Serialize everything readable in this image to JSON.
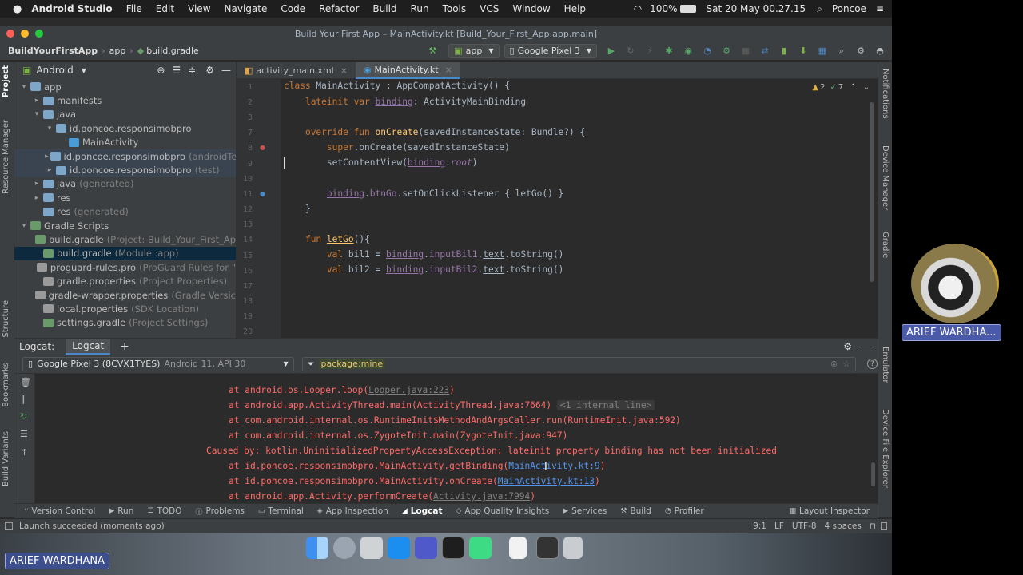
{
  "menubar": {
    "app": "Android Studio",
    "items": [
      "File",
      "Edit",
      "View",
      "Navigate",
      "Code",
      "Refactor",
      "Build",
      "Run",
      "Tools",
      "VCS",
      "Window",
      "Help"
    ],
    "battery": "100%",
    "clock": "Sat 20 May  00.27.15",
    "user": "Poncoe"
  },
  "window": {
    "title": "Build Your First App – MainActivity.kt [Build_Your_First_App.app.main]"
  },
  "nav": {
    "breadcrumb": [
      "BuildYourFirstApp",
      "app",
      "build.gradle"
    ],
    "module": "app",
    "device": "Google Pixel 3"
  },
  "side_left": [
    "Project",
    "Resource Manager",
    "Structure",
    "Bookmarks",
    "Build Variants"
  ],
  "side_right": [
    "Notifications",
    "Device Manager",
    "Gradle",
    "Emulator",
    "Device File Explorer"
  ],
  "project": {
    "view": "Android",
    "rows": [
      {
        "indent": 0,
        "arrow": "▾",
        "label": "app",
        "hint": "",
        "color": "#7ea6c9"
      },
      {
        "indent": 1,
        "arrow": "▸",
        "label": "manifests",
        "hint": "",
        "color": "#7ea6c9"
      },
      {
        "indent": 1,
        "arrow": "▾",
        "label": "java",
        "hint": "",
        "color": "#7ea6c9"
      },
      {
        "indent": 2,
        "arrow": "▾",
        "label": "id.poncoe.responsimobpro",
        "hint": "",
        "color": "#7ea6c9"
      },
      {
        "indent": 3,
        "arrow": "",
        "label": "MainActivity",
        "hint": "",
        "color": "#4a9cd6"
      },
      {
        "indent": 2,
        "arrow": "▸",
        "label": "id.poncoe.responsimobpro",
        "hint": "(androidTe",
        "color": "#7ea6c9",
        "sel": true
      },
      {
        "indent": 2,
        "arrow": "▸",
        "label": "id.poncoe.responsimobpro",
        "hint": "(test)",
        "color": "#7ea6c9",
        "sel": true
      },
      {
        "indent": 1,
        "arrow": "▸",
        "label": "java",
        "hint": "(generated)",
        "color": "#7ea6c9"
      },
      {
        "indent": 1,
        "arrow": "▸",
        "label": "res",
        "hint": "",
        "color": "#7ea6c9"
      },
      {
        "indent": 1,
        "arrow": "",
        "label": "res",
        "hint": "(generated)",
        "color": "#7ea6c9"
      },
      {
        "indent": 0,
        "arrow": "▾",
        "label": "Gradle Scripts",
        "hint": "",
        "color": "#6a9a6a"
      },
      {
        "indent": 1,
        "arrow": "",
        "label": "build.gradle",
        "hint": "(Project: Build_Your_First_Ap",
        "color": "#6a9a6a"
      },
      {
        "indent": 1,
        "arrow": "",
        "label": "build.gradle",
        "hint": "(Module :app)",
        "color": "#6a9a6a",
        "sel2": true
      },
      {
        "indent": 1,
        "arrow": "",
        "label": "proguard-rules.pro",
        "hint": "(ProGuard Rules for \"",
        "color": "#9a9a9a"
      },
      {
        "indent": 1,
        "arrow": "",
        "label": "gradle.properties",
        "hint": "(Project Properties)",
        "color": "#9a9a9a"
      },
      {
        "indent": 1,
        "arrow": "",
        "label": "gradle-wrapper.properties",
        "hint": "(Gradle Versic",
        "color": "#9a9a9a"
      },
      {
        "indent": 1,
        "arrow": "",
        "label": "local.properties",
        "hint": "(SDK Location)",
        "color": "#9a9a9a"
      },
      {
        "indent": 1,
        "arrow": "",
        "label": "settings.gradle",
        "hint": "(Project Settings)",
        "color": "#6a9a6a"
      }
    ]
  },
  "editor": {
    "tabs": [
      "activity_main.xml",
      "MainActivity.kt"
    ],
    "inspection": {
      "warnings": "2",
      "weak": "7"
    },
    "line_numbers": [
      "1",
      "2",
      "3",
      "7",
      "8",
      "9",
      "10",
      "11",
      "12",
      "13",
      "14",
      "15",
      "16",
      "17",
      "18",
      "19",
      "20"
    ]
  },
  "logcat": {
    "tabs": [
      "Logcat:",
      "Logcat"
    ],
    "device": "Google Pixel 3 (8CVX1TYES)",
    "device_hint": "Android 11, API 30",
    "filter": "package:mine"
  },
  "tool_windows": [
    "Version Control",
    "Run",
    "TODO",
    "Problems",
    "Terminal",
    "App Inspection",
    "Logcat",
    "App Quality Insights",
    "Services",
    "Build",
    "Profiler"
  ],
  "layout_inspector": "Layout Inspector",
  "status": {
    "message": "Launch succeeded (moments ago)",
    "position": "9:1",
    "line_sep": "LF",
    "encoding": "UTF-8",
    "indent": "4 spaces"
  },
  "overlay": {
    "cam_name": "ARIEF WARDHA...",
    "presenter": "ARIEF WARDHANA"
  }
}
